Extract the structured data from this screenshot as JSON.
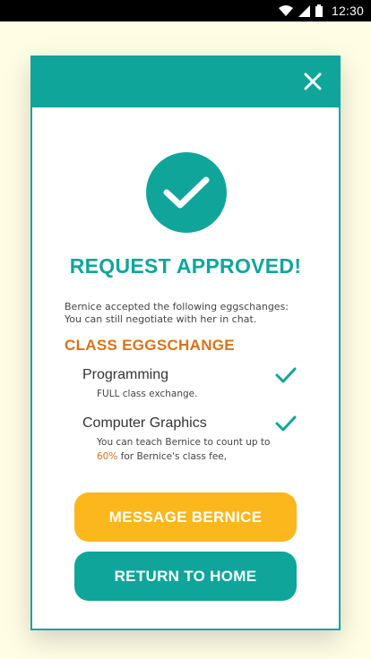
{
  "status_bar": {
    "time": "12:30",
    "icons": [
      "wifi-icon",
      "signal-icon",
      "battery-icon"
    ]
  },
  "dialog": {
    "close_icon": "close-icon",
    "success_icon": "checkmark-icon",
    "title": "REQUEST APPROVED!",
    "intro_line1": "Bernice accepted the following eggschanges:",
    "intro_line2": "You can still negotiate with her in chat.",
    "section_title": "CLASS EGGSCHANGE",
    "items": [
      {
        "name": "Programming",
        "desc_line1": "FULL class exchange.",
        "check_icon": "checkmark-icon"
      },
      {
        "name": "Computer Graphics",
        "desc_line1": "You can teach Bernice to count up to",
        "desc_highlight": "60%",
        "desc_line2_rest": " for Bernice's class fee,",
        "check_icon": "checkmark-icon"
      }
    ],
    "message_button": "MESSAGE BERNICE",
    "home_button": "RETURN TO HOME"
  },
  "colors": {
    "teal": "#0fa59b",
    "yellow": "#fbb71c",
    "orange": "#d8731a",
    "background": "#fffde4"
  }
}
